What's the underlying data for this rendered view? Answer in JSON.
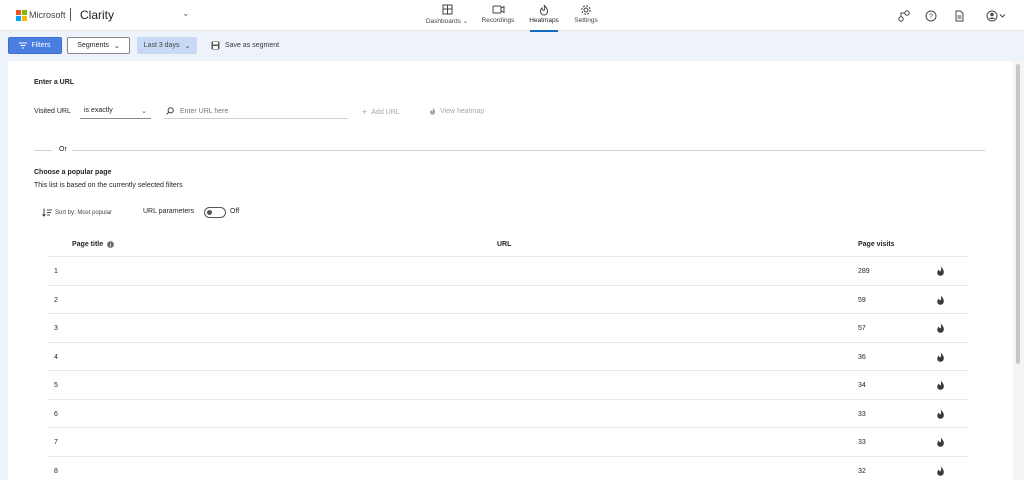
{
  "header": {
    "brand": "Microsoft",
    "product": "Clarity",
    "nav": [
      {
        "label": "Dashboards ⌄",
        "icon": "dashboard-icon"
      },
      {
        "label": "Recordings",
        "icon": "video-icon"
      },
      {
        "label": "Heatmaps",
        "icon": "flame-icon",
        "active": true
      },
      {
        "label": "Settings",
        "icon": "gear-icon"
      }
    ],
    "colors": {
      "accent": "#0f6cbd",
      "ms_red": "#f25022",
      "ms_green": "#7fba00",
      "ms_blue": "#00a4ef",
      "ms_yellow": "#ffb900"
    }
  },
  "toolbar": {
    "filters_label": "Filters",
    "segments_label": "Segments",
    "date_range_label": "Last 3 days",
    "save_segment_label": "Save as segment"
  },
  "enter_url": {
    "heading": "Enter a URL",
    "visited_label": "Visited URL",
    "match_type": "is exactly",
    "url_placeholder": "Enter URL here",
    "add_url_label": "Add URL",
    "view_heatmap_label": "View heatmap"
  },
  "or_label": "Or",
  "popular": {
    "heading": "Choose a popular page",
    "subtitle": "This list is based on the currently selected filters",
    "sort_label": "Sort by: Most popular",
    "url_params_label": "URL parameters",
    "url_params_state": "Off"
  },
  "table": {
    "columns": {
      "title": "Page title",
      "url": "URL",
      "visits": "Page visits"
    },
    "rows": [
      {
        "index": "1",
        "visits": "289"
      },
      {
        "index": "2",
        "visits": "59"
      },
      {
        "index": "3",
        "visits": "57"
      },
      {
        "index": "4",
        "visits": "36"
      },
      {
        "index": "5",
        "visits": "34"
      },
      {
        "index": "6",
        "visits": "33"
      },
      {
        "index": "7",
        "visits": "33"
      },
      {
        "index": "8",
        "visits": "32"
      }
    ]
  }
}
